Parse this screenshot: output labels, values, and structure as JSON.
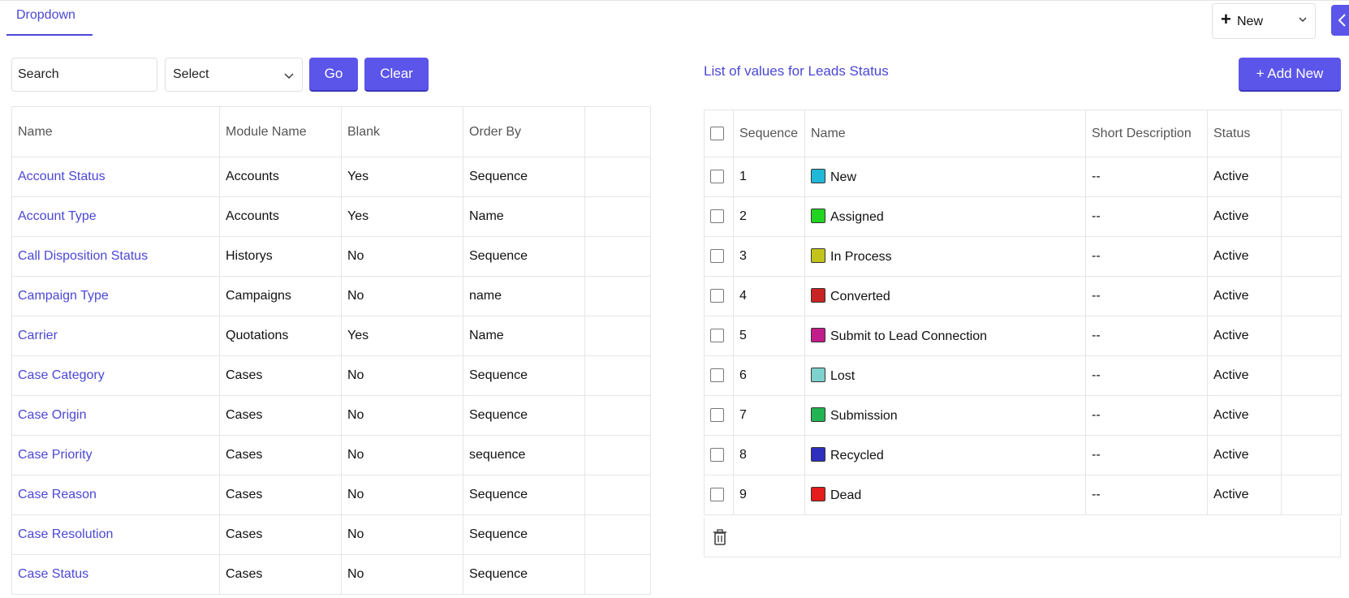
{
  "tabs": [
    {
      "label": "Dropdown"
    }
  ],
  "new_dropdown": {
    "icon": "plus-icon",
    "label": "New"
  },
  "filters": {
    "search_value": "Search",
    "select_value": "Select",
    "go_label": "Go",
    "clear_label": "Clear"
  },
  "left_table": {
    "columns": [
      "Name",
      "Module Name",
      "Blank",
      "Order By",
      ""
    ],
    "rows": [
      {
        "name": "Account Status",
        "module": "Accounts",
        "blank": "Yes",
        "order_by": "Sequence"
      },
      {
        "name": "Account Type",
        "module": "Accounts",
        "blank": "Yes",
        "order_by": "Name"
      },
      {
        "name": "Call Disposition Status",
        "module": "Historys",
        "blank": "No",
        "order_by": "Sequence"
      },
      {
        "name": "Campaign Type",
        "module": "Campaigns",
        "blank": "No",
        "order_by": "name"
      },
      {
        "name": "Carrier",
        "module": "Quotations",
        "blank": "Yes",
        "order_by": "Name"
      },
      {
        "name": "Case Category",
        "module": "Cases",
        "blank": "No",
        "order_by": "Sequence"
      },
      {
        "name": "Case Origin",
        "module": "Cases",
        "blank": "No",
        "order_by": "Sequence"
      },
      {
        "name": "Case Priority",
        "module": "Cases",
        "blank": "No",
        "order_by": "sequence"
      },
      {
        "name": "Case Reason",
        "module": "Cases",
        "blank": "No",
        "order_by": "Sequence"
      },
      {
        "name": "Case Resolution",
        "module": "Cases",
        "blank": "No",
        "order_by": "Sequence"
      },
      {
        "name": "Case Status",
        "module": "Cases",
        "blank": "No",
        "order_by": "Sequence"
      }
    ]
  },
  "right_panel": {
    "title": "List of values for Leads Status",
    "add_new_label": "+ Add New",
    "columns": [
      "Sequence",
      "Name",
      "Short Description",
      "Status",
      ""
    ],
    "rows": [
      {
        "sequence": "1",
        "name": "New",
        "color": "#1fb8d6",
        "short_description": "--",
        "status": "Active"
      },
      {
        "sequence": "2",
        "name": "Assigned",
        "color": "#22d422",
        "short_description": "--",
        "status": "Active"
      },
      {
        "sequence": "3",
        "name": "In Process",
        "color": "#c2c41c",
        "short_description": "--",
        "status": "Active"
      },
      {
        "sequence": "4",
        "name": "Converted",
        "color": "#c92424",
        "short_description": "--",
        "status": "Active"
      },
      {
        "sequence": "5",
        "name": "Submit to Lead Connection",
        "color": "#c21c8a",
        "short_description": "--",
        "status": "Active"
      },
      {
        "sequence": "6",
        "name": "Lost",
        "color": "#7ed1cc",
        "short_description": "--",
        "status": "Active"
      },
      {
        "sequence": "7",
        "name": "Submission",
        "color": "#22b353",
        "short_description": "--",
        "status": "Active"
      },
      {
        "sequence": "8",
        "name": "Recycled",
        "color": "#2e2ebf",
        "short_description": "--",
        "status": "Active"
      },
      {
        "sequence": "9",
        "name": "Dead",
        "color": "#e51c1c",
        "short_description": "--",
        "status": "Active"
      }
    ],
    "footer_icon": "trash-icon"
  },
  "colors": {
    "accent": "#5b55ea",
    "link": "#4b47d6",
    "border": "#e6e6e6"
  }
}
